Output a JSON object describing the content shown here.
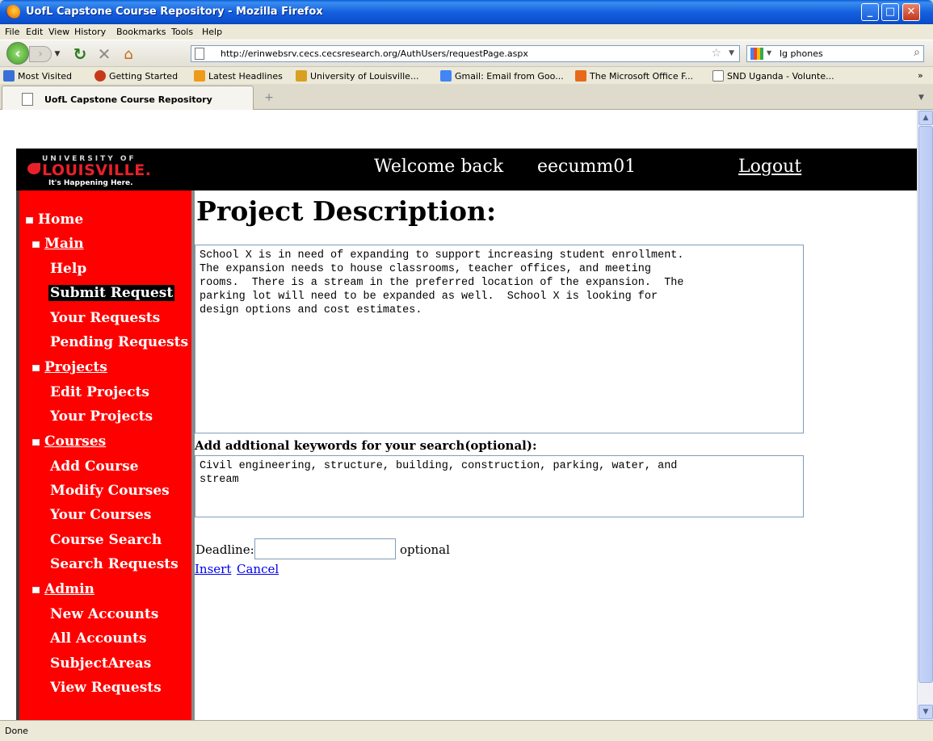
{
  "window": {
    "title": "UofL Capstone Course Repository - Mozilla Firefox"
  },
  "menu": {
    "items": [
      "File",
      "Edit",
      "View",
      "History",
      "Bookmarks",
      "Tools",
      "Help"
    ]
  },
  "toolbar": {
    "url": "http://erinwebsrv.cecs.cecsresearch.org/AuthUsers/requestPage.aspx",
    "search_value": "lg phones"
  },
  "bookmarks": [
    {
      "label": "Most Visited",
      "color": "#3a6fd8"
    },
    {
      "label": "Getting Started",
      "color": "#c8391a"
    },
    {
      "label": "Latest Headlines",
      "color": "#f09a1a"
    },
    {
      "label": "University of Louisville...",
      "color": "#d8a020"
    },
    {
      "label": "Gmail: Email from Goo...",
      "color": "#4285f4"
    },
    {
      "label": "The Microsoft Office F...",
      "color": "#e66a1a"
    },
    {
      "label": "SND Uganda - Volunte...",
      "color": "#ffffff"
    }
  ],
  "tab": {
    "label": "UofL Capstone Course Repository"
  },
  "header": {
    "logo_top": "UNIVERSITY OF",
    "logo_main": "LOUISVILLE.",
    "logo_tagline": "It's Happening Here.",
    "welcome": "Welcome back",
    "username": "eecumm01",
    "logout": "Logout"
  },
  "sidebar": {
    "items": [
      {
        "label": "Home",
        "level": 1,
        "marker": true
      },
      {
        "label": "Main",
        "level": 2,
        "marker": true,
        "underline": true
      },
      {
        "label": "Help",
        "level": 3
      },
      {
        "label": "Submit Request",
        "level": 3,
        "selected": true
      },
      {
        "label": "Your Requests",
        "level": 3
      },
      {
        "label": "Pending Requests",
        "level": 3
      },
      {
        "label": "Projects",
        "level": 2,
        "marker": true,
        "underline": true
      },
      {
        "label": "Edit Projects",
        "level": 3
      },
      {
        "label": "Your Projects",
        "level": 3
      },
      {
        "label": "Courses",
        "level": 2,
        "marker": true,
        "underline": true
      },
      {
        "label": "Add Course",
        "level": 3
      },
      {
        "label": "Modify Courses",
        "level": 3
      },
      {
        "label": "Your Courses",
        "level": 3
      },
      {
        "label": "Course Search",
        "level": 3
      },
      {
        "label": "Search Requests",
        "level": 3
      },
      {
        "label": "Admin",
        "level": 2,
        "marker": true,
        "underline": true
      },
      {
        "label": "New Accounts",
        "level": 3
      },
      {
        "label": "All Accounts",
        "level": 3
      },
      {
        "label": "SubjectAreas",
        "level": 3
      },
      {
        "label": "View Requests",
        "level": 3
      }
    ]
  },
  "main": {
    "title": "Project Description:",
    "description": "School X is in need of expanding to support increasing student enrollment.\nThe expansion needs to house classrooms, teacher offices, and meeting\nrooms.  There is a stream in the preferred location of the expansion.  The\nparking lot will need to be expanded as well.  School X is looking for\ndesign options and cost estimates.",
    "keywords_label": "Add addtional keywords for your search(optional):",
    "keywords": "Civil engineering, structure, building, construction, parking, water, and\nstream",
    "deadline_label": "Deadline:",
    "deadline_value": "",
    "optional_label": "optional",
    "insert": "Insert",
    "cancel": "Cancel"
  },
  "status": {
    "text": "Done"
  },
  "colors": {
    "sidebar_bg": "#ff0000",
    "header_bg": "#000000",
    "link": "#0000ee"
  }
}
